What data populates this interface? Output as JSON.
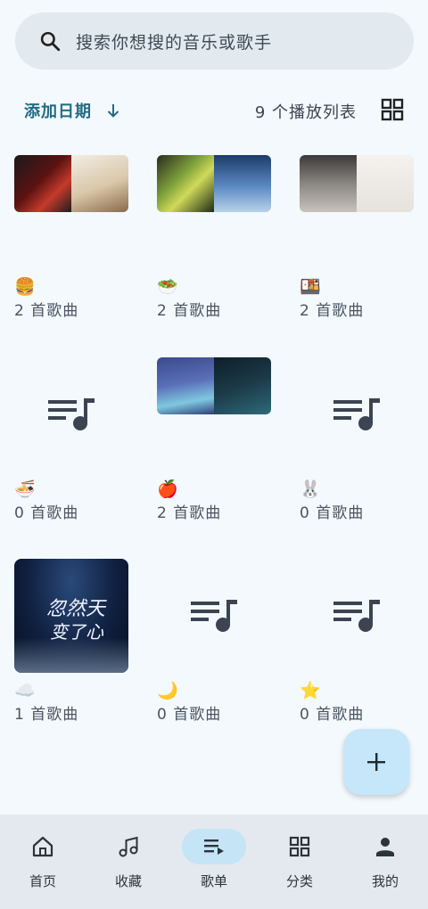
{
  "search": {
    "placeholder": "搜索你想搜的音乐或歌手",
    "icon": "search-icon"
  },
  "toolbar": {
    "sort_label": "添加日期",
    "count": "9 个播放列表"
  },
  "playlists": [
    {
      "emoji": "🍔",
      "songs": "2 首歌曲"
    },
    {
      "emoji": "🥗",
      "songs": "2 首歌曲"
    },
    {
      "emoji": "🍱",
      "songs": "2 首歌曲"
    },
    {
      "emoji": "🍜",
      "songs": "0 首歌曲"
    },
    {
      "emoji": "🍎",
      "songs": "2 首歌曲"
    },
    {
      "emoji": "🐰",
      "songs": "0 首歌曲"
    },
    {
      "emoji": "☁️",
      "songs": "1 首歌曲"
    },
    {
      "emoji": "🌙",
      "songs": "0 首歌曲"
    },
    {
      "emoji": "⭐",
      "songs": "0 首歌曲"
    }
  ],
  "cover_text": {
    "title_line1": "忽然天",
    "title_line2": "变了心"
  },
  "nav": [
    {
      "label": "首页",
      "icon": "home-icon"
    },
    {
      "label": "收藏",
      "icon": "music-note-icon"
    },
    {
      "label": "歌单",
      "icon": "playlist-icon"
    },
    {
      "label": "分类",
      "icon": "grid-icon"
    },
    {
      "label": "我的",
      "icon": "person-icon"
    }
  ],
  "colors": {
    "background": "#f3f9fd",
    "accent": "#226b82",
    "nav_active": "#c5e4f6",
    "fab": "#c6e6fa"
  }
}
